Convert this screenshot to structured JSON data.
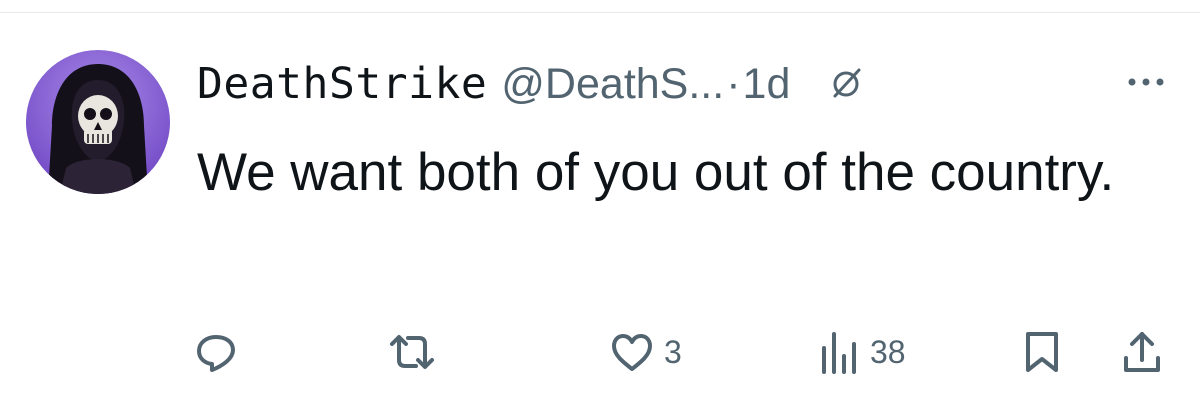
{
  "tweet": {
    "author": {
      "display_name": "DeathStrike",
      "handle": "@DeathS...",
      "avatar": "hooded-skull-avatar"
    },
    "separator": "·",
    "time_ago": "1d",
    "text": "We want both of you out of the country.",
    "actions": {
      "reply": {
        "icon": "reply-icon",
        "count": ""
      },
      "repost": {
        "icon": "repost-icon",
        "count": ""
      },
      "like": {
        "icon": "heart-icon",
        "count": "3"
      },
      "views": {
        "icon": "views-icon",
        "count": "38"
      },
      "bookmark": {
        "icon": "bookmark-icon"
      },
      "share": {
        "icon": "share-icon"
      }
    }
  },
  "colors": {
    "text_primary": "#0f1419",
    "text_secondary": "#536471",
    "avatar_background": "#8e63d8"
  }
}
